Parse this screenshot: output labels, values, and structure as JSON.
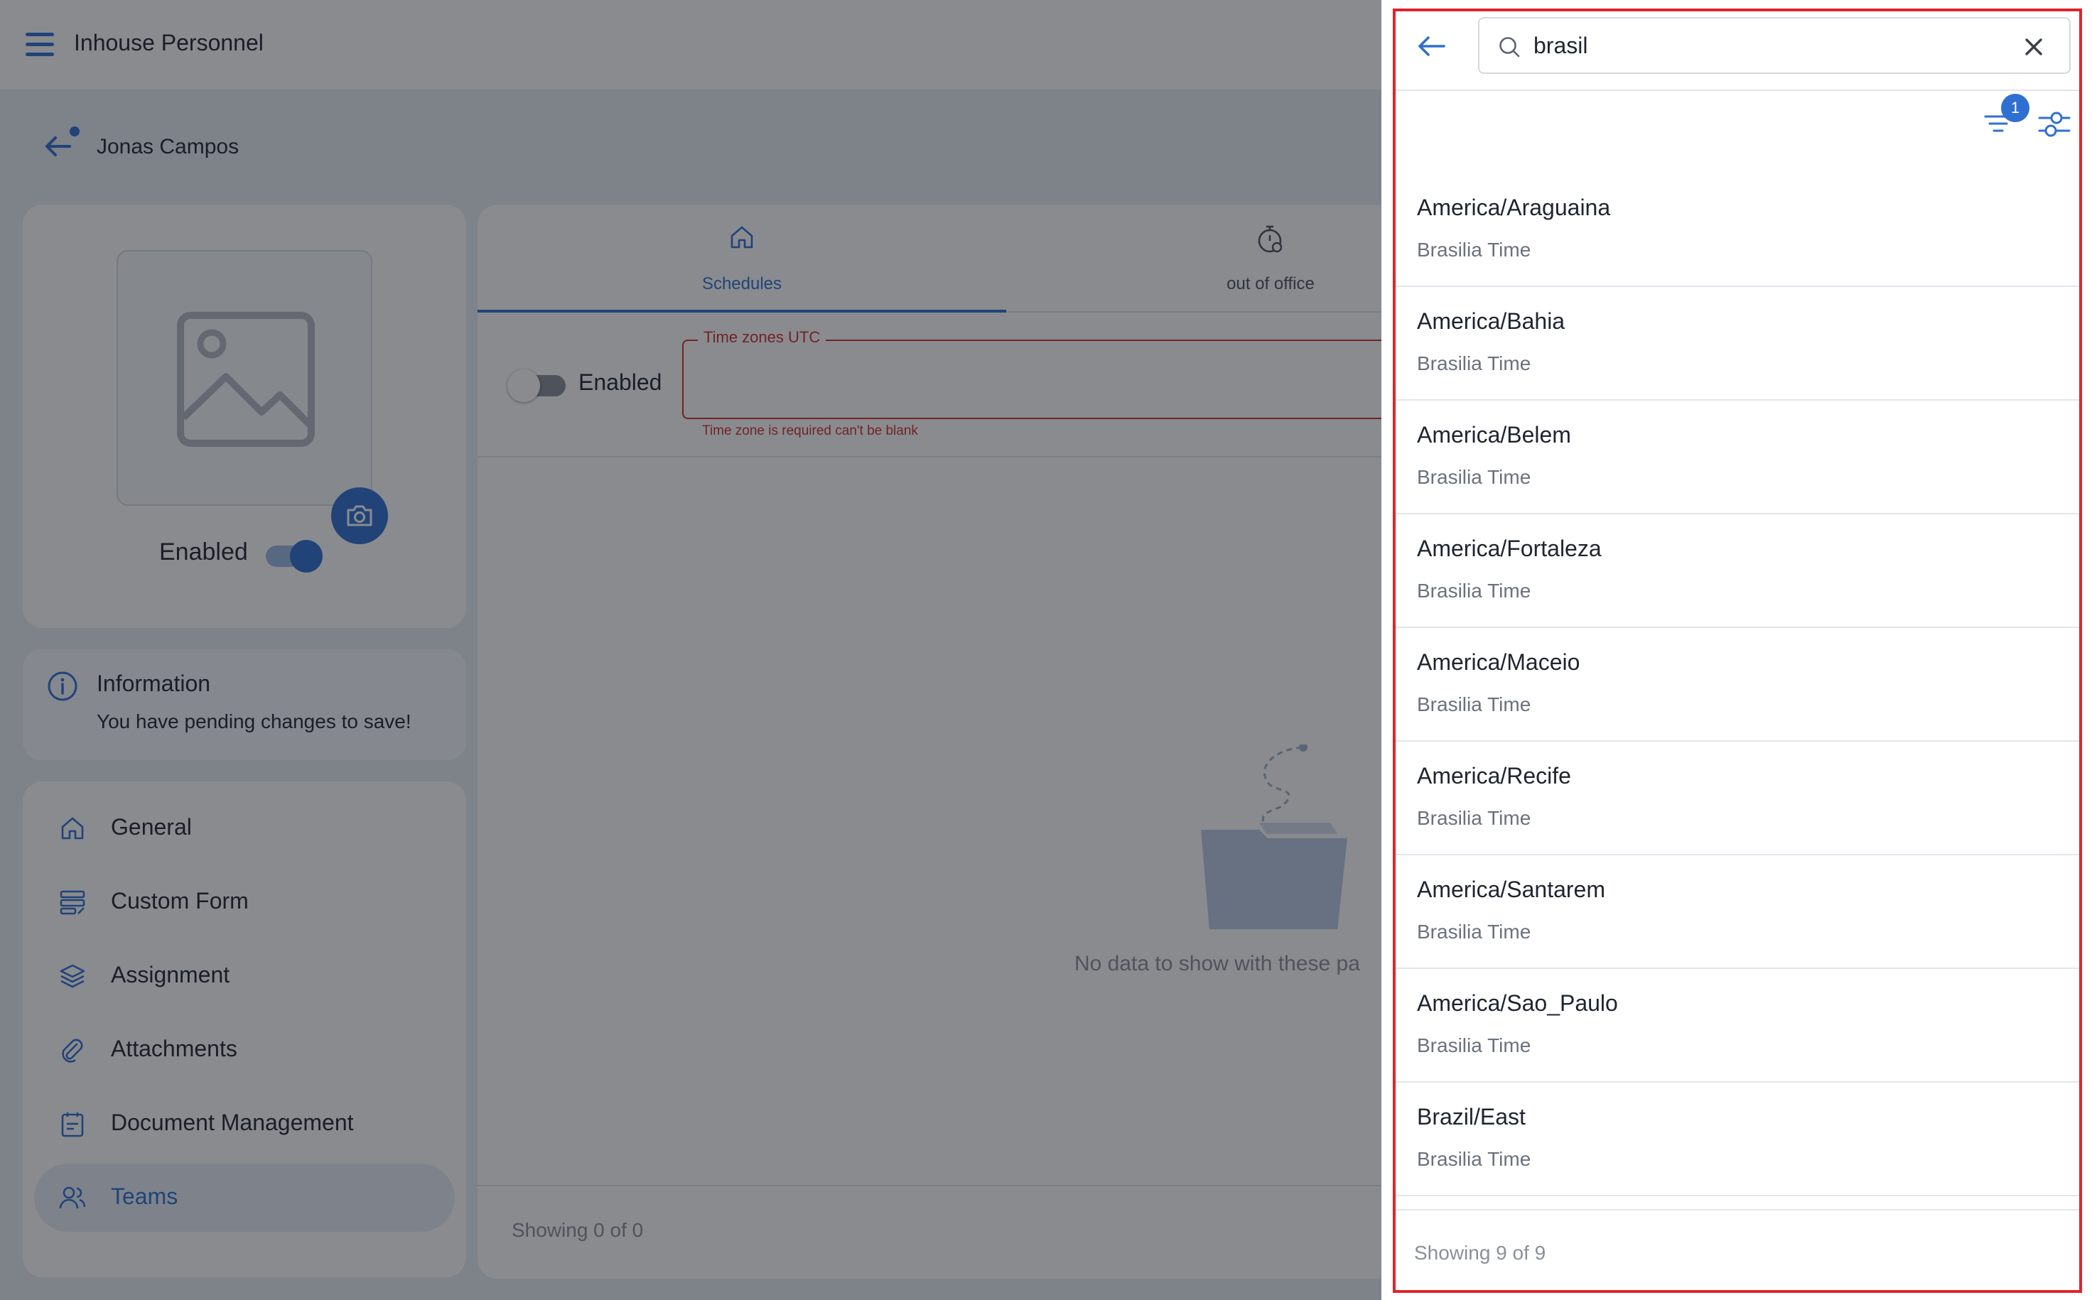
{
  "app": {
    "title": "Inhouse Personnel"
  },
  "breadcrumb": {
    "name": "Jonas Campos"
  },
  "profile": {
    "enabled_label": "Enabled",
    "enabled": true
  },
  "info": {
    "title": "Information",
    "text": "You have pending changes to save!"
  },
  "nav": {
    "items": [
      {
        "label": "General",
        "icon": "home-icon"
      },
      {
        "label": "Custom Form",
        "icon": "form-icon"
      },
      {
        "label": "Assignment",
        "icon": "layers-icon"
      },
      {
        "label": "Attachments",
        "icon": "paperclip-icon"
      },
      {
        "label": "Document Management",
        "icon": "document-icon"
      },
      {
        "label": "Teams",
        "icon": "team-icon",
        "active": true
      }
    ]
  },
  "main": {
    "tabs": [
      {
        "label": "Schedules",
        "icon": "home-icon",
        "active": true
      },
      {
        "label": "out of office",
        "icon": "stopwatch-icon"
      }
    ],
    "enabled_label": "Enabled",
    "enabled": false,
    "timezone_label": "Time zones UTC",
    "timezone_error": "Time zone is required can't be blank",
    "empty_text": "No data to show with these pa",
    "showing": "Showing 0 of 0"
  },
  "panel": {
    "search_value": "brasil",
    "filter_count": "1",
    "timezones": [
      {
        "name": "America/Araguaina",
        "desc": "Brasilia Time"
      },
      {
        "name": "America/Bahia",
        "desc": "Brasilia Time"
      },
      {
        "name": "America/Belem",
        "desc": "Brasilia Time"
      },
      {
        "name": "America/Fortaleza",
        "desc": "Brasilia Time"
      },
      {
        "name": "America/Maceio",
        "desc": "Brasilia Time"
      },
      {
        "name": "America/Recife",
        "desc": "Brasilia Time"
      },
      {
        "name": "America/Santarem",
        "desc": "Brasilia Time"
      },
      {
        "name": "America/Sao_Paulo",
        "desc": "Brasilia Time"
      },
      {
        "name": "Brazil/East",
        "desc": "Brasilia Time"
      }
    ],
    "showing": "Showing 9 of 9"
  },
  "colors": {
    "accent": "#2f6fd1",
    "error": "#d32f2f",
    "highlight": "#e0242b"
  }
}
